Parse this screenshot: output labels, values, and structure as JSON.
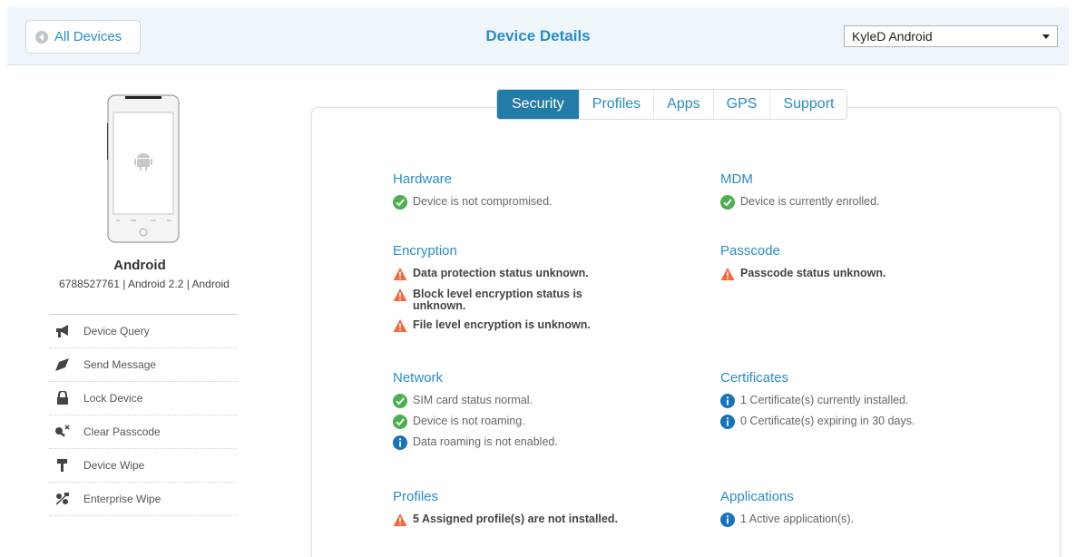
{
  "header": {
    "back_label": "All Devices",
    "title": "Device Details",
    "device_selected": "KyleD Android"
  },
  "device": {
    "name": "Android",
    "meta": "6788527761 | Android 2.2 | Android"
  },
  "actions": [
    {
      "label": "Device Query",
      "icon": "megaphone-icon"
    },
    {
      "label": "Send Message",
      "icon": "send-icon"
    },
    {
      "label": "Lock Device",
      "icon": "lock-icon"
    },
    {
      "label": "Clear Passcode",
      "icon": "key-clear-icon"
    },
    {
      "label": "Device Wipe",
      "icon": "wipe-icon"
    },
    {
      "label": "Enterprise Wipe",
      "icon": "enterprise-wipe-icon"
    }
  ],
  "tabs": [
    "Security",
    "Profiles",
    "Apps",
    "GPS",
    "Support"
  ],
  "active_tab": "Security",
  "sections": {
    "hardware": {
      "title": "Hardware",
      "items": [
        {
          "status": "ok",
          "text": "Device is not compromised."
        }
      ]
    },
    "mdm": {
      "title": "MDM",
      "items": [
        {
          "status": "ok",
          "text": "Device is currently enrolled."
        }
      ]
    },
    "encryption": {
      "title": "Encryption",
      "items": [
        {
          "status": "warn",
          "text": "Data protection status unknown."
        },
        {
          "status": "warn",
          "text": "Block level encryption status is unknown."
        },
        {
          "status": "warn",
          "text": "File level encryption is unknown."
        }
      ]
    },
    "passcode": {
      "title": "Passcode",
      "items": [
        {
          "status": "warn",
          "text": "Passcode status unknown."
        }
      ]
    },
    "network": {
      "title": "Network",
      "items": [
        {
          "status": "ok",
          "text": "SIM card status normal."
        },
        {
          "status": "ok",
          "text": "Device is not roaming."
        },
        {
          "status": "info",
          "text": "Data roaming is not enabled."
        }
      ]
    },
    "certificates": {
      "title": "Certificates",
      "items": [
        {
          "status": "info",
          "text": "1 Certificate(s) currently installed."
        },
        {
          "status": "info",
          "text": "0 Certificate(s) expiring in 30 days."
        }
      ]
    },
    "profiles": {
      "title": "Profiles",
      "items": [
        {
          "status": "warn",
          "text": "5 Assigned profile(s) are not installed."
        }
      ]
    },
    "applications": {
      "title": "Applications",
      "items": [
        {
          "status": "info",
          "text": "1 Active application(s)."
        }
      ]
    }
  },
  "colors": {
    "accent": "#2b8cc4",
    "tab_active": "#237ba8",
    "ok": "#4caf50",
    "warn": "#f26a3d",
    "info": "#1a73b8"
  }
}
